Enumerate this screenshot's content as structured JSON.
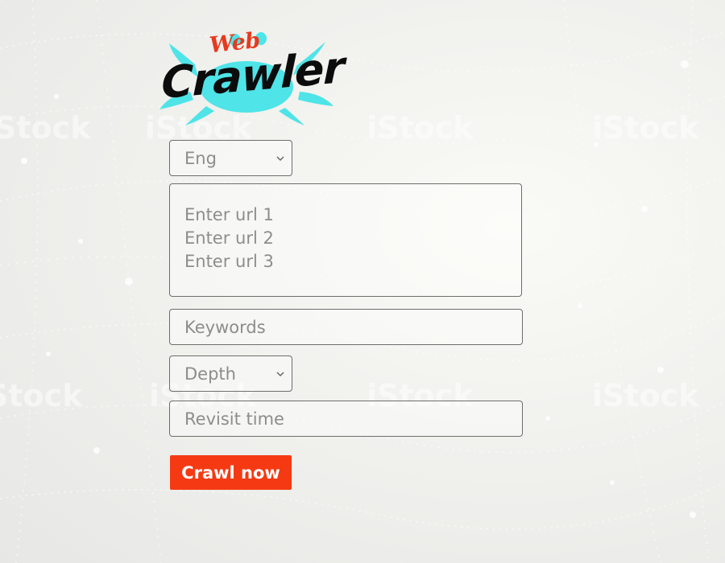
{
  "logo": {
    "small_text": "Web",
    "main_text": "Crawler",
    "crab_color": "#4ee4e8",
    "small_text_color": "#e63a1e"
  },
  "form": {
    "language_select": {
      "selected": "Eng",
      "icon": "chevron-down-icon"
    },
    "url_textarea": {
      "placeholder_lines": [
        "Enter url 1",
        "Enter url 2",
        "Enter url 3"
      ]
    },
    "keywords_input": {
      "placeholder": "Keywords"
    },
    "depth_select": {
      "selected": "Depth",
      "icon": "chevron-down-icon"
    },
    "revisit_input": {
      "placeholder": "Revisit time"
    },
    "submit_button": {
      "label": "Crawl now",
      "color": "#f53a13"
    }
  },
  "background": {
    "watermark_text": "iStock"
  }
}
